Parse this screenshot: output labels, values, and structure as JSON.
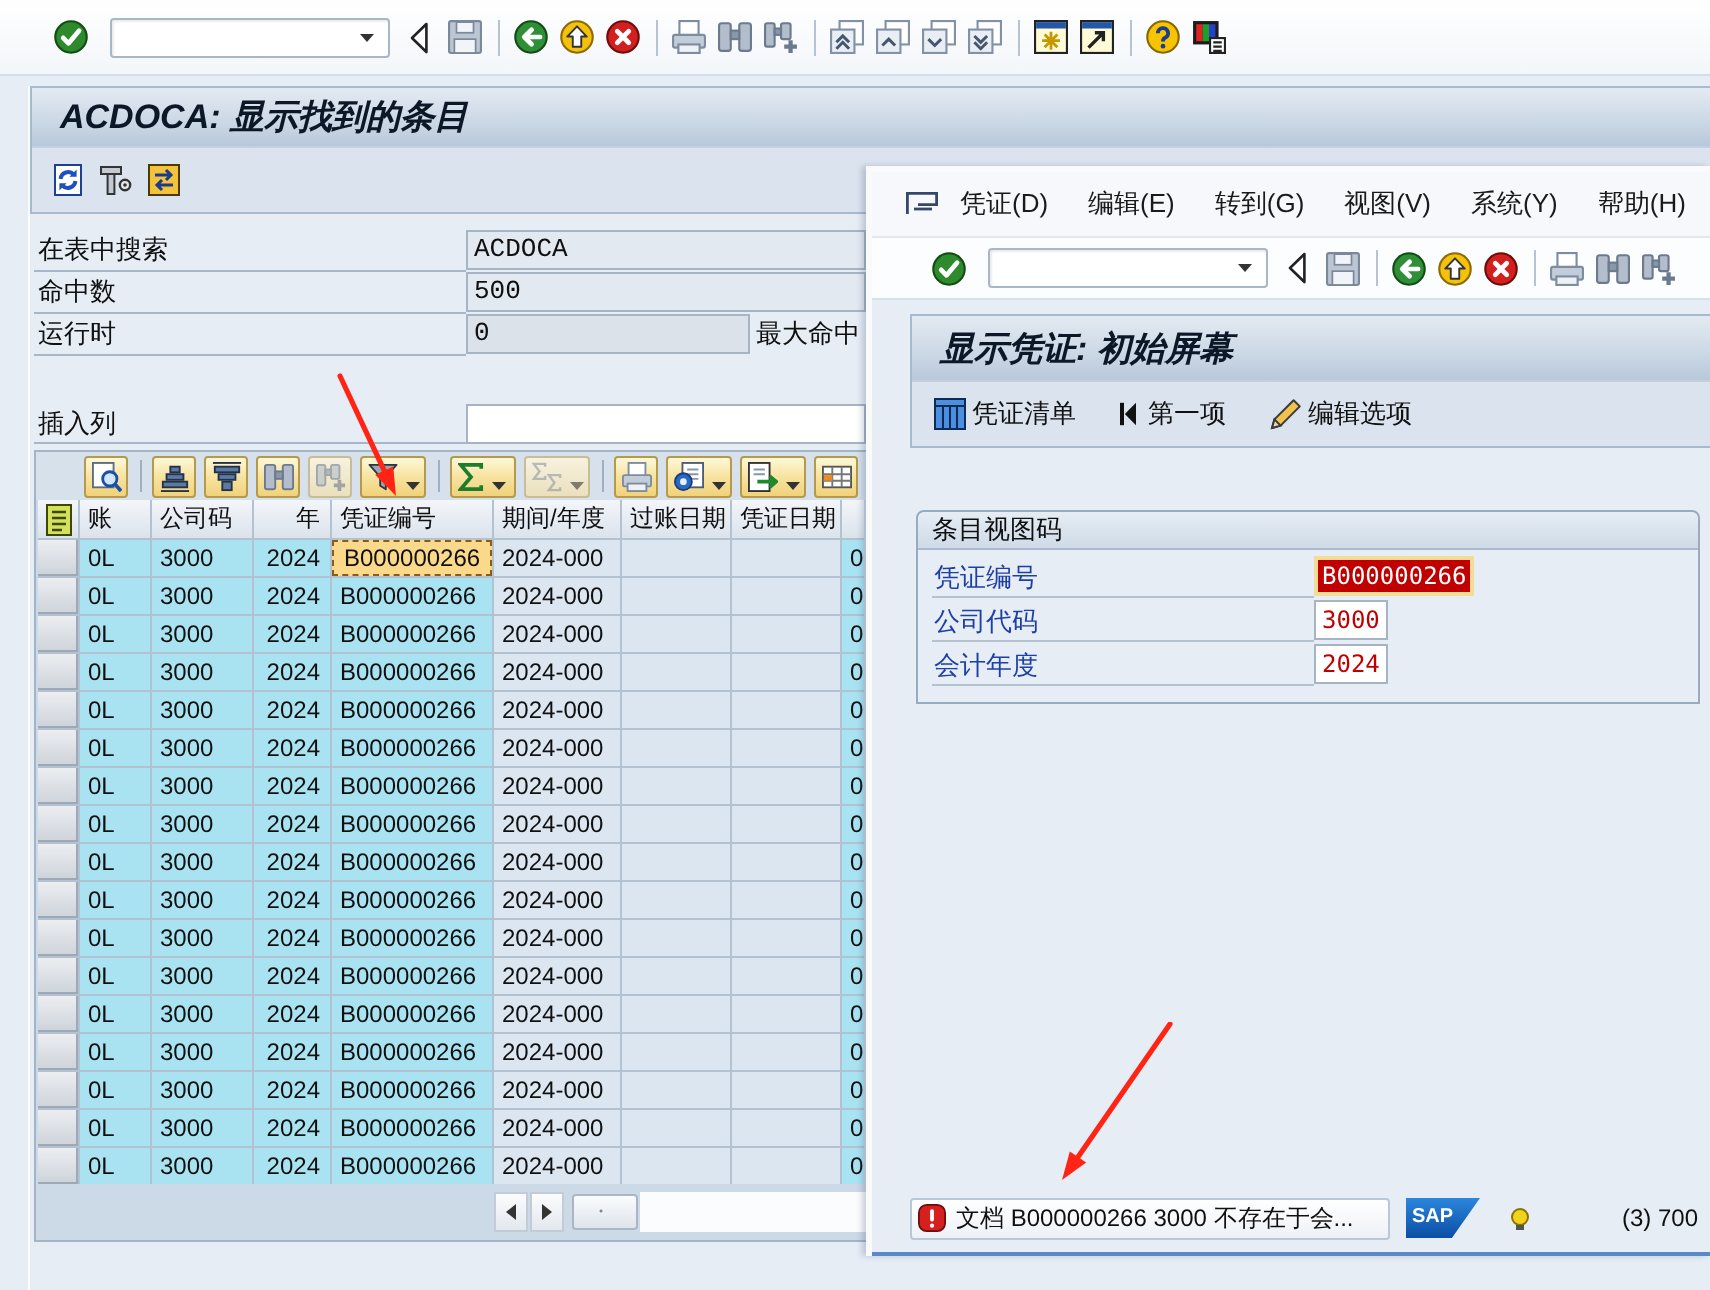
{
  "toolbar": {
    "groups": [
      {
        "items": [
          {
            "kind": "enter"
          },
          {
            "kind": "command_field"
          },
          {
            "kind": "back"
          },
          {
            "kind": "save"
          }
        ]
      },
      {
        "items": [
          {
            "kind": "back_arrow"
          },
          {
            "kind": "exit"
          },
          {
            "kind": "cancel"
          }
        ]
      },
      {
        "items": [
          {
            "kind": "print"
          },
          {
            "kind": "find"
          },
          {
            "kind": "find_next"
          }
        ]
      },
      {
        "items": [
          {
            "kind": "first_page"
          },
          {
            "kind": "previous_page"
          },
          {
            "kind": "next_page"
          },
          {
            "kind": "last_page"
          }
        ]
      },
      {
        "items": [
          {
            "kind": "new_session"
          },
          {
            "kind": "shortcut"
          }
        ]
      },
      {
        "items": [
          {
            "kind": "help"
          },
          {
            "kind": "customize"
          }
        ]
      }
    ]
  },
  "main_window": {
    "title": "ACDOCA: 显示找到的条目",
    "app_toolbar": [
      {
        "kind": "refresh"
      },
      {
        "kind": "tool"
      },
      {
        "kind": "transfer"
      }
    ],
    "fields": [
      {
        "label": "在表中搜索",
        "value": "ACDOCA"
      },
      {
        "label": "命中数",
        "value": "500"
      },
      {
        "label": "运行时",
        "value": "0",
        "side_label": "最大命中"
      }
    ],
    "insert_column": {
      "label": "插入列"
    },
    "table": {
      "toolbar_groups": [
        {
          "buttons": [
            {
              "kind": "details",
              "dropdown": false,
              "disabled": false
            }
          ]
        },
        {
          "buttons": [
            {
              "kind": "sort_ascending",
              "dropdown": false,
              "disabled": false
            },
            {
              "kind": "sort_descending",
              "dropdown": false,
              "disabled": false
            },
            {
              "kind": "find",
              "dropdown": false,
              "disabled": false
            },
            {
              "kind": "find_next",
              "dropdown": false,
              "disabled": true
            },
            {
              "kind": "filter",
              "dropdown": true,
              "disabled": false
            }
          ]
        },
        {
          "buttons": [
            {
              "kind": "sum",
              "dropdown": true,
              "disabled": false
            },
            {
              "kind": "subtotal",
              "dropdown": true,
              "disabled": true
            }
          ]
        },
        {
          "buttons": [
            {
              "kind": "print",
              "dropdown": false,
              "disabled": false
            },
            {
              "kind": "views",
              "dropdown": true,
              "disabled": false
            },
            {
              "kind": "export",
              "dropdown": true,
              "disabled": false
            },
            {
              "kind": "layout",
              "dropdown": false,
              "disabled": false
            }
          ]
        }
      ],
      "columns": [
        {
          "label": "账",
          "kind": "text",
          "key": true,
          "focused": false
        },
        {
          "label": "公司码",
          "kind": "text",
          "key": true,
          "focused": false
        },
        {
          "label": "年",
          "kind": "number",
          "key": true,
          "focused": false
        },
        {
          "label": "凭证编号",
          "kind": "text",
          "key": true,
          "focused": true
        },
        {
          "label": "期间/年度",
          "kind": "text",
          "key": false,
          "focused": false
        },
        {
          "label": "过账日期",
          "kind": "text",
          "key": false,
          "focused": false
        },
        {
          "label": "凭证日期",
          "kind": "text",
          "key": false,
          "focused": false
        },
        {
          "kind": "text",
          "key": true,
          "focused": false
        }
      ],
      "rows": [
        {
          "selected": true,
          "cells": [
            "0L",
            "3000",
            "2024",
            "B000000266",
            "2024-000",
            null,
            null,
            "0"
          ]
        },
        {
          "selected": false,
          "cells": [
            "0L",
            "3000",
            "2024",
            "B000000266",
            "2024-000",
            null,
            null,
            "0"
          ]
        },
        {
          "selected": false,
          "cells": [
            "0L",
            "3000",
            "2024",
            "B000000266",
            "2024-000",
            null,
            null,
            "0"
          ]
        },
        {
          "selected": false,
          "cells": [
            "0L",
            "3000",
            "2024",
            "B000000266",
            "2024-000",
            null,
            null,
            "0"
          ]
        },
        {
          "selected": false,
          "cells": [
            "0L",
            "3000",
            "2024",
            "B000000266",
            "2024-000",
            null,
            null,
            "0"
          ]
        },
        {
          "selected": false,
          "cells": [
            "0L",
            "3000",
            "2024",
            "B000000266",
            "2024-000",
            null,
            null,
            "0"
          ]
        },
        {
          "selected": false,
          "cells": [
            "0L",
            "3000",
            "2024",
            "B000000266",
            "2024-000",
            null,
            null,
            "0"
          ]
        },
        {
          "selected": false,
          "cells": [
            "0L",
            "3000",
            "2024",
            "B000000266",
            "2024-000",
            null,
            null,
            "0"
          ]
        },
        {
          "selected": false,
          "cells": [
            "0L",
            "3000",
            "2024",
            "B000000266",
            "2024-000",
            null,
            null,
            "0"
          ]
        },
        {
          "selected": false,
          "cells": [
            "0L",
            "3000",
            "2024",
            "B000000266",
            "2024-000",
            null,
            null,
            "0"
          ]
        },
        {
          "selected": false,
          "cells": [
            "0L",
            "3000",
            "2024",
            "B000000266",
            "2024-000",
            null,
            null,
            "0"
          ]
        },
        {
          "selected": false,
          "cells": [
            "0L",
            "3000",
            "2024",
            "B000000266",
            "2024-000",
            null,
            null,
            "0"
          ]
        },
        {
          "selected": false,
          "cells": [
            "0L",
            "3000",
            "2024",
            "B000000266",
            "2024-000",
            null,
            null,
            "0"
          ]
        },
        {
          "selected": false,
          "cells": [
            "0L",
            "3000",
            "2024",
            "B000000266",
            "2024-000",
            null,
            null,
            "0"
          ]
        },
        {
          "selected": false,
          "cells": [
            "0L",
            "3000",
            "2024",
            "B000000266",
            "2024-000",
            null,
            null,
            "0"
          ]
        },
        {
          "selected": false,
          "cells": [
            "0L",
            "3000",
            "2024",
            "B000000266",
            "2024-000",
            null,
            null,
            "0"
          ]
        },
        {
          "selected": false,
          "cells": [
            "0L",
            "3000",
            "2024",
            "B000000266",
            "2024-000",
            null,
            null,
            "0"
          ]
        }
      ]
    }
  },
  "document_window": {
    "menu": [
      {
        "label": "凭证(D)"
      },
      {
        "label": "编辑(E)"
      },
      {
        "label": "转到(G)"
      },
      {
        "label": "视图(V)"
      },
      {
        "label": "系统(Y)"
      },
      {
        "label": "帮助(H)"
      }
    ],
    "toolbar": {
      "groups": [
        {
          "items": [
            {
              "kind": "enter"
            },
            {
              "kind": "command_field"
            },
            {
              "kind": "back"
            },
            {
              "kind": "save"
            }
          ]
        },
        {
          "items": [
            {
              "kind": "back_arrow"
            },
            {
              "kind": "exit"
            },
            {
              "kind": "cancel"
            }
          ]
        },
        {
          "items": [
            {
              "kind": "print"
            },
            {
              "kind": "find"
            },
            {
              "kind": "find_next"
            }
          ]
        }
      ]
    },
    "title": "显示凭证: 初始屏幕",
    "app_toolbar": [
      {
        "kind": "document_list",
        "label": "凭证清单"
      },
      {
        "kind": "first_item",
        "label": "第一项"
      },
      {
        "kind": "edit_options",
        "label": "编辑选项"
      }
    ],
    "group": {
      "title": "条目视图码",
      "fields": [
        {
          "label": "凭证编号",
          "value": "B000000266",
          "selected": true
        },
        {
          "label": "公司代码",
          "value": "3000",
          "selected": false
        },
        {
          "label": "会计年度",
          "value": "2024",
          "selected": false
        }
      ]
    },
    "status_bar": {
      "error": true,
      "message": "文档 B000000266 3000 不存在于会...",
      "logo": "SAP",
      "system": "(3) 700"
    }
  },
  "annotations": [
    {
      "kind": "arrow"
    },
    {
      "kind": "arrow"
    }
  ]
}
